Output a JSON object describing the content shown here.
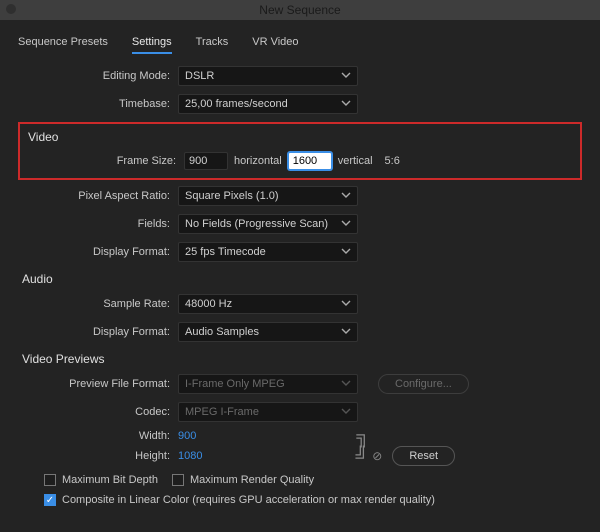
{
  "title": "New Sequence",
  "tabs": [
    "Sequence Presets",
    "Settings",
    "Tracks",
    "VR Video"
  ],
  "active_tab": 1,
  "editing": {
    "mode_label": "Editing Mode:",
    "mode_value": "DSLR",
    "timebase_label": "Timebase:",
    "timebase_value": "25,00  frames/second"
  },
  "video": {
    "section": "Video",
    "frame_size_label": "Frame Size:",
    "width": "900",
    "horizontal": "horizontal",
    "height": "1600",
    "vertical": "vertical",
    "aspect": "5:6",
    "par_label": "Pixel Aspect Ratio:",
    "par_value": "Square Pixels (1.0)",
    "fields_label": "Fields:",
    "fields_value": "No Fields (Progressive Scan)",
    "display_format_label": "Display Format:",
    "display_format_value": "25 fps Timecode"
  },
  "audio": {
    "section": "Audio",
    "sample_rate_label": "Sample Rate:",
    "sample_rate_value": "48000 Hz",
    "display_format_label": "Display Format:",
    "display_format_value": "Audio Samples"
  },
  "previews": {
    "section": "Video Previews",
    "file_format_label": "Preview File Format:",
    "file_format_value": "I-Frame Only MPEG",
    "configure_label": "Configure...",
    "codec_label": "Codec:",
    "codec_value": "MPEG I-Frame",
    "width_label": "Width:",
    "width_value": "900",
    "height_label": "Height:",
    "height_value": "1080",
    "reset_label": "Reset"
  },
  "checks": {
    "max_bit_depth": "Maximum Bit Depth",
    "max_render_quality": "Maximum Render Quality",
    "composite_linear": "Composite in Linear Color (requires GPU acceleration or max render quality)"
  }
}
